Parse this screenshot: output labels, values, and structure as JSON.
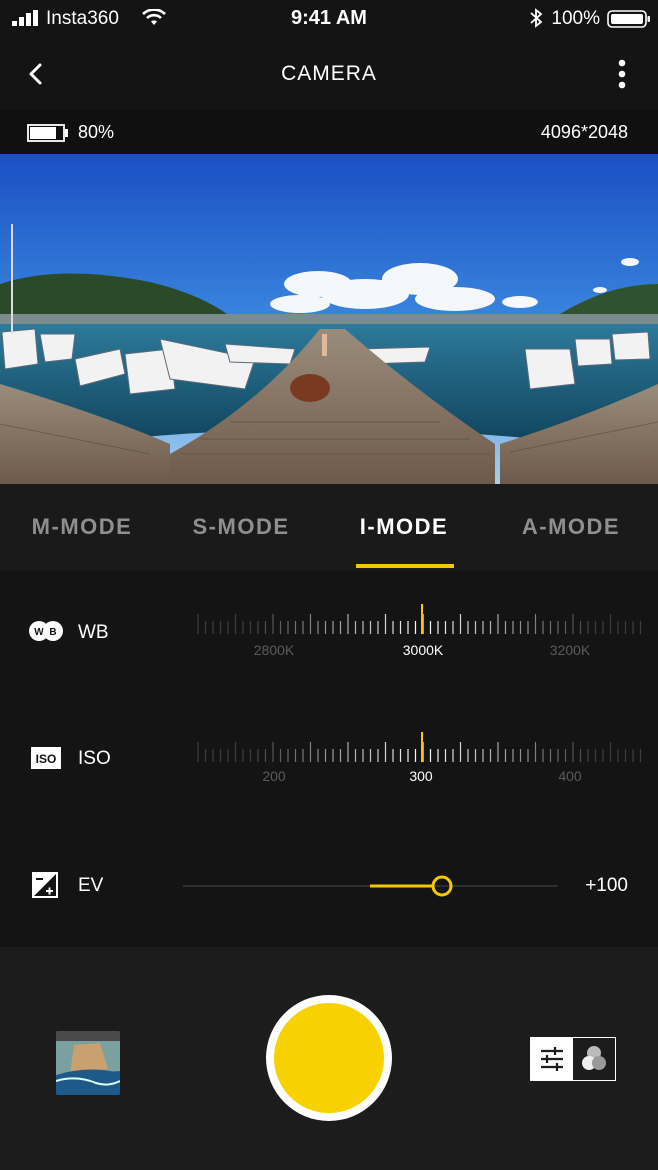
{
  "status_bar": {
    "carrier": "Insta360",
    "time": "9:41 AM",
    "battery_pct": "100%"
  },
  "header": {
    "title": "CAMERA"
  },
  "info_bar": {
    "battery": "80%",
    "resolution": "4096*2048"
  },
  "tabs": [
    {
      "label": "M-MODE"
    },
    {
      "label": "S-MODE"
    },
    {
      "label": "I-MODE",
      "active": true
    },
    {
      "label": "A-MODE"
    }
  ],
  "wb": {
    "label": "WB",
    "ticks": [
      "2800K",
      "3000K",
      "3200K"
    ],
    "selected": "3000K"
  },
  "iso": {
    "label": "ISO",
    "ticks": [
      "200",
      "300",
      "400"
    ],
    "selected": "300"
  },
  "ev": {
    "label": "EV",
    "value": "+100"
  },
  "colors": {
    "accent": "#f7d200",
    "background": "#141414"
  }
}
